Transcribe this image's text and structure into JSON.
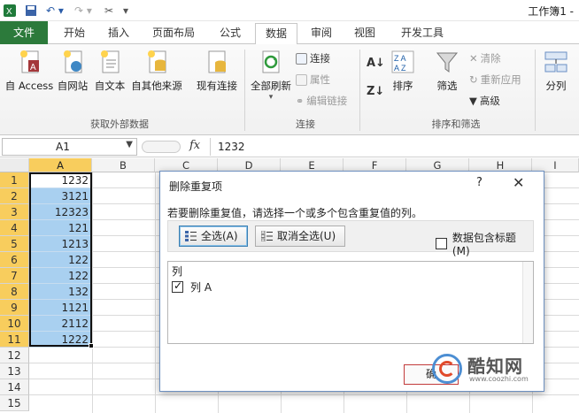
{
  "window": {
    "title": "工作簿1 -"
  },
  "tabs": [
    "文件",
    "开始",
    "插入",
    "页面布局",
    "公式",
    "数据",
    "审阅",
    "视图",
    "开发工具"
  ],
  "active_tab": "数据",
  "ribbon": {
    "get_external": {
      "access": "自 Access",
      "web": "自网站",
      "text": "自文本",
      "other": "自其他来源",
      "existing": "现有连接",
      "label": "获取外部数据"
    },
    "connections": {
      "refresh_all": "全部刷新",
      "connections": "连接",
      "properties": "属性",
      "edit_links": "编辑链接",
      "label": "连接"
    },
    "sort_filter": {
      "sort": "排序",
      "filter": "筛选",
      "clear": "清除",
      "reapply": "重新应用",
      "advanced": "高级",
      "label": "排序和筛选"
    },
    "split": "分列"
  },
  "formula_bar": {
    "name_box": "A1",
    "fx": "fx",
    "formula": "1232"
  },
  "columns": [
    "A",
    "B",
    "C",
    "D",
    "E",
    "F",
    "G",
    "H",
    "I"
  ],
  "rows": [
    "1",
    "2",
    "3",
    "4",
    "5",
    "6",
    "7",
    "8",
    "9",
    "10",
    "11",
    "12",
    "13",
    "14",
    "15"
  ],
  "column_a_values": [
    "1232",
    "3121",
    "12323",
    "121",
    "1213",
    "122",
    "122",
    "132",
    "1121",
    "2112",
    "1222"
  ],
  "dialog": {
    "title": "删除重复项",
    "help": "?",
    "close": "✕",
    "description": "若要删除重复值，请选择一个或多个包含重复值的列。",
    "select_all": "全选(A)",
    "unselect_all": "取消全选(U)",
    "has_headers": "数据包含标题(M)",
    "has_headers_checked": false,
    "list_header": "列",
    "columns": [
      {
        "label": "列 A",
        "checked": true
      }
    ],
    "ok_partial": "确"
  },
  "watermark": {
    "brand": "酷知网",
    "url": "www.coozhi.com"
  },
  "colors": {
    "file_tab": "#2c7a3b",
    "selection": "#a9d0f0",
    "header_selected": "#f8cd5d"
  }
}
